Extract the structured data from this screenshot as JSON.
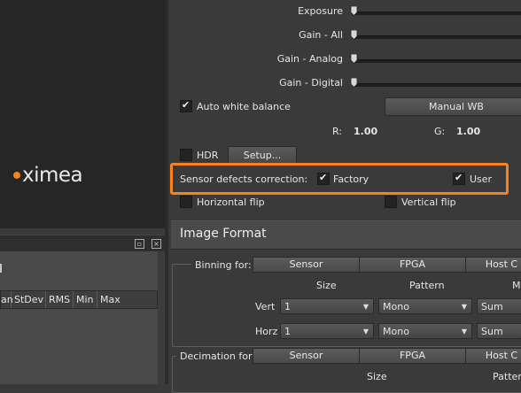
{
  "preview": {
    "logo_text": "ximea",
    "accent_color": "#f0821e"
  },
  "stats": {
    "columns": [
      "an",
      "StDev",
      "RMS",
      "Min",
      "Max"
    ],
    "pin_icon": "pin-icon",
    "close_icon": "close-icon"
  },
  "sliders": [
    {
      "label": "Exposure",
      "level": 0
    },
    {
      "label": "Gain - All",
      "level": 0
    },
    {
      "label": "Gain - Analog",
      "level": 0
    },
    {
      "label": "Gain - Digital",
      "level": 0
    }
  ],
  "white_balance": {
    "auto_label": "Auto white balance",
    "auto_checked": true,
    "manual_button": "Manual WB",
    "r_label": "R:",
    "r_value": "1.00",
    "g_label": "G:",
    "g_value": "1.00"
  },
  "hdr": {
    "label": "HDR",
    "checked": false,
    "setup_button": "Setup..."
  },
  "sensor_defects": {
    "label": "Sensor defects correction:",
    "factory_label": "Factory",
    "factory_checked": true,
    "user_label": "User",
    "user_checked": true,
    "highlight_color": "#f7821f"
  },
  "flip": {
    "horizontal_label": "Horizontal flip",
    "vertical_label": "Vertical flip"
  },
  "image_format": {
    "title": "Image Format",
    "binning": {
      "label": "Binning for:",
      "tabs": [
        "Sensor",
        "FPGA",
        "Host C"
      ],
      "col_size": "Size",
      "col_pattern": "Pattern",
      "col_mode": "M",
      "vert_label": "Vert",
      "horz_label": "Horz",
      "vert_size": "1",
      "vert_pattern": "Mono",
      "vert_mode": "Sum",
      "horz_size": "1",
      "horz_pattern": "Mono",
      "horz_mode": "Sum"
    },
    "decimation": {
      "label": "Decimation for:",
      "tabs": [
        "Sensor",
        "FPGA",
        "Host C"
      ],
      "col_size": "Size",
      "col_pattern": "Pattern"
    }
  }
}
